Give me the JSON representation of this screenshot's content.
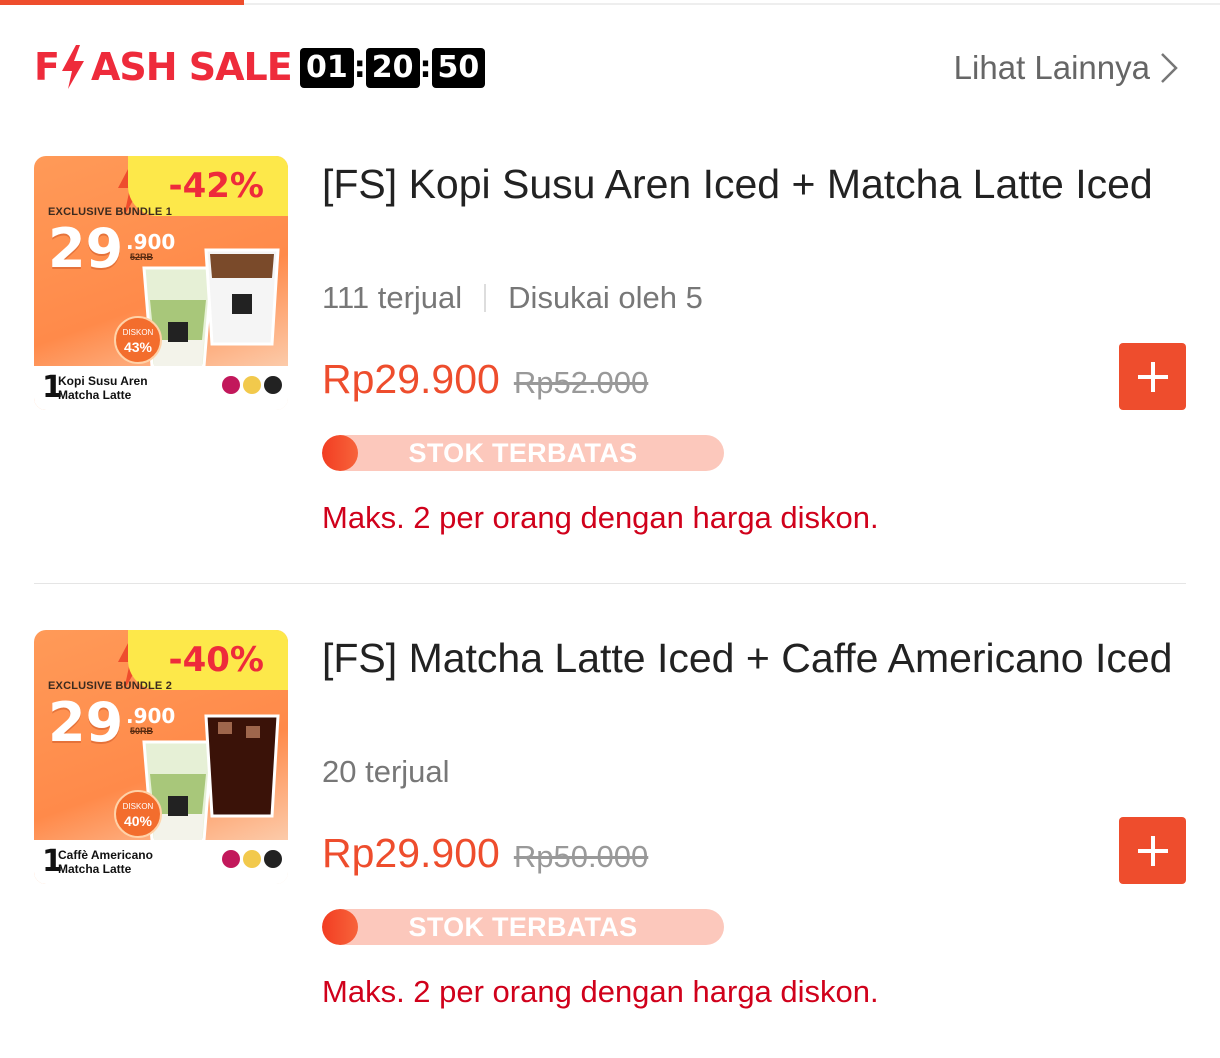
{
  "colors": {
    "accent": "#ee4d2d",
    "flash_red": "#ee2b3b",
    "limit_red": "#d0011b"
  },
  "top_progress": {
    "fraction": 0.2
  },
  "header": {
    "logo_left": "F",
    "logo_right": "ASH SALE",
    "timer": {
      "hours": "01",
      "minutes": "20",
      "seconds": "50"
    },
    "see_more": "Lihat Lainnya"
  },
  "products": [
    {
      "title": "[FS] Kopi Susu Aren Iced + Matcha Latte Iced",
      "sold": "111 terjual",
      "liked": "Disukai oleh 5",
      "price": "Rp29.900",
      "original_price": "Rp52.000",
      "stock_label": "STOK TERBATAS",
      "stock_level": 0.08,
      "limit_text": "Maks. 2 per orang dengan harga diskon.",
      "thumb": {
        "discount": "-42%",
        "bundle": "EXCLUSIVE BUNDLE 1",
        "big": "29",
        "big_small": ".900",
        "old_small": "52RB",
        "disc_word": "DISKON",
        "disc_pct": "43%",
        "qty": "1",
        "name1": "Kopi Susu Aren",
        "name2": "Matcha Latte"
      }
    },
    {
      "title": "[FS] Matcha Latte Iced + Caffe Americano Iced",
      "sold": "20 terjual",
      "liked": "",
      "price": "Rp29.900",
      "original_price": "Rp50.000",
      "stock_label": "STOK TERBATAS",
      "stock_level": 0.08,
      "limit_text": "Maks. 2 per orang dengan harga diskon.",
      "thumb": {
        "discount": "-40%",
        "bundle": "EXCLUSIVE BUNDLE 2",
        "big": "29",
        "big_small": ".900",
        "old_small": "50RB",
        "disc_word": "DISKON",
        "disc_pct": "40%",
        "qty": "1",
        "name1": "Caffè Americano",
        "name2": "Matcha Latte"
      }
    }
  ]
}
